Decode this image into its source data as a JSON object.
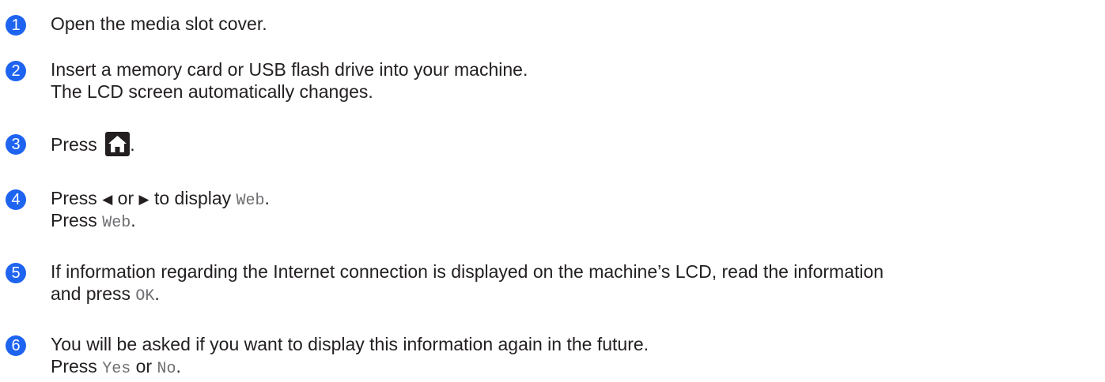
{
  "steps": [
    {
      "number": "1",
      "line1": "Open the media slot cover."
    },
    {
      "number": "2",
      "line1": "Insert a memory card or USB flash drive into your machine.",
      "line2": "The LCD screen automatically changes."
    },
    {
      "number": "3",
      "prefix": "Press ",
      "icon": "home-icon",
      "suffix": "."
    },
    {
      "number": "4",
      "l1_prefix": "Press ",
      "left_arrow": "◀",
      "or": " or ",
      "right_arrow": "▶",
      "to_display": " to display ",
      "web_label": "Web",
      "l1_suffix": ".",
      "l2_prefix": "Press ",
      "l2_web": "Web",
      "l2_suffix": "."
    },
    {
      "number": "5",
      "line1": "If information regarding the Internet connection is displayed on the machine’s LCD, read the information",
      "l2_prefix": "and press ",
      "ok_label": "OK",
      "l2_suffix": "."
    },
    {
      "number": "6",
      "line1": "You will be asked if you want to display this information again in the future.",
      "l2_prefix": "Press ",
      "yes_label": "Yes",
      "or": " or ",
      "no_label": "No",
      "l2_suffix": "."
    }
  ],
  "colors": {
    "badge": "#1e64f0",
    "text": "#231f20",
    "mono": "#6d6e71"
  }
}
